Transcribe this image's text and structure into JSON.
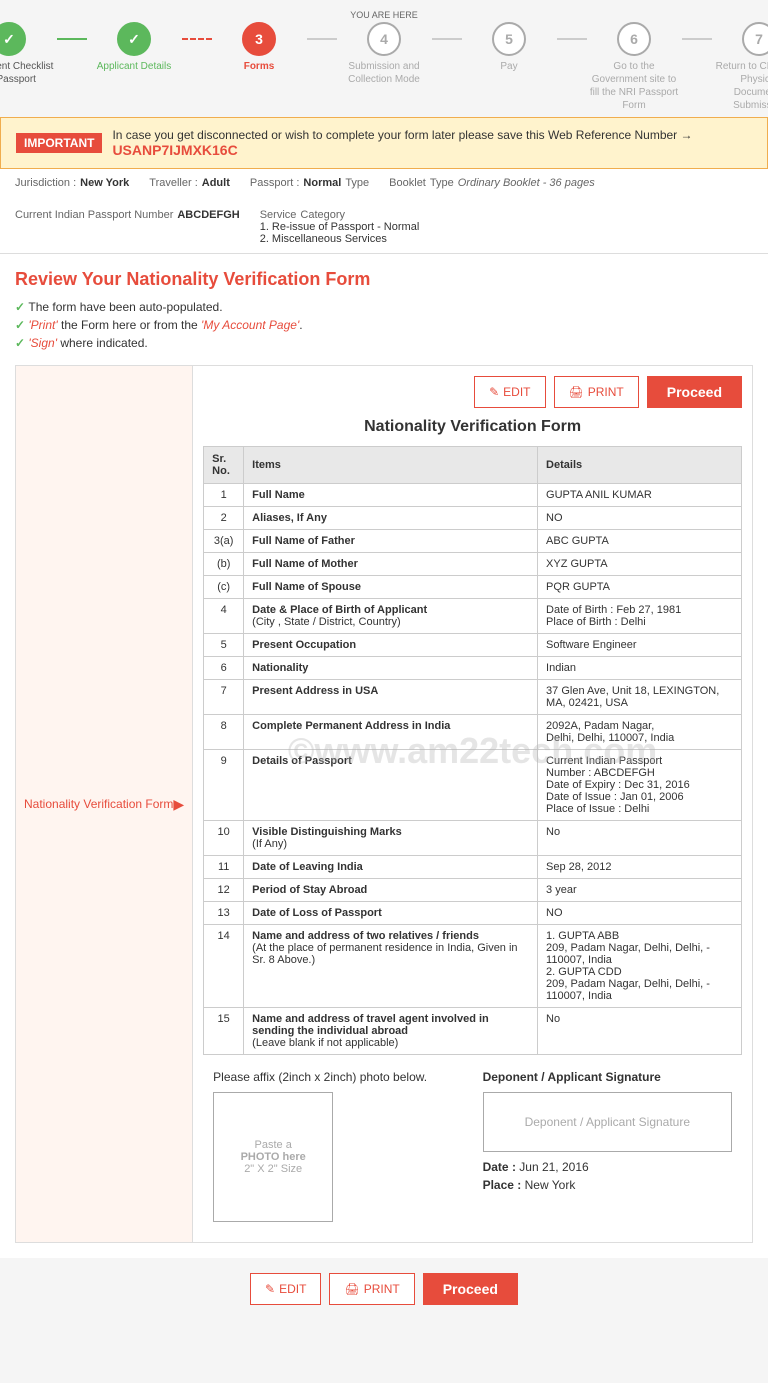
{
  "you_are_here": "YOU ARE HERE",
  "steps": [
    {
      "id": 1,
      "label": "Document Checklist for Passport",
      "state": "done",
      "icon": "✓"
    },
    {
      "id": 2,
      "label": "Applicant Details",
      "state": "done",
      "icon": "✓"
    },
    {
      "id": 3,
      "label": "Forms",
      "state": "active",
      "icon": "3"
    },
    {
      "id": 4,
      "label": "Submission and Collection Mode",
      "state": "inactive",
      "icon": "4"
    },
    {
      "id": 5,
      "label": "Pay",
      "state": "inactive",
      "icon": "5"
    },
    {
      "id": 6,
      "label": "Go to the Government site to fill the NRI Passport Form",
      "state": "inactive",
      "icon": "6"
    },
    {
      "id": 7,
      "label": "Return to CKGS for Physical Documents Submission",
      "state": "inactive",
      "icon": "7"
    }
  ],
  "banner": {
    "label": "IMPORTANT",
    "text": "In case you get disconnected or wish to complete your form later please save this Web Reference Number →",
    "ref_number": "USANP7IJMXK16C"
  },
  "info": {
    "jurisdiction_label": "Jurisdiction :",
    "jurisdiction_value": "New York",
    "traveller_label": "Traveller :",
    "traveller_value": "Adult",
    "passport_label": "Passport :",
    "passport_value": "Normal",
    "passport_type_label": "Type",
    "booklet_label": "Booklet",
    "booklet_type_label": "Type",
    "booklet_value": "Ordinary Booklet - 36 pages",
    "current_passport_label": "Current Indian Passport Number",
    "current_passport_value": "ABCDEFGH",
    "service_label": "Service",
    "service_cat_label": "Category",
    "service_value1": "1. Re-issue of Passport - Normal",
    "service_value2": "2. Miscellaneous Services"
  },
  "review": {
    "title_pre": "Review Your ",
    "title_highlight": "Nationality Verification Form",
    "checklist": [
      "The form have been auto-populated.",
      "'Print' the Form here or from the 'My Account Page'.",
      "'Sign' where indicated."
    ]
  },
  "sidebar": {
    "label": "Nationality Verification Form"
  },
  "form": {
    "title": "Nationality Verification Form",
    "edit_btn": "EDIT",
    "print_btn": "PRINT",
    "proceed_btn": "Proceed",
    "table_headers": [
      "Sr. No.",
      "Items",
      "Details"
    ],
    "rows": [
      {
        "sr": "1",
        "item": "Full Name",
        "detail": "GUPTA ANIL KUMAR",
        "bold": true,
        "sub": ""
      },
      {
        "sr": "2",
        "item": "Aliases, If Any",
        "detail": "NO",
        "bold": true,
        "sub": ""
      },
      {
        "sr": "3(a)",
        "item": "Full Name of Father",
        "detail": "ABC GUPTA",
        "bold": true,
        "sub": ""
      },
      {
        "sr": "(b)",
        "item": "Full Name of Mother",
        "detail": "XYZ GUPTA",
        "bold": true,
        "sub": ""
      },
      {
        "sr": "(c)",
        "item": "Full Name of Spouse",
        "detail": "PQR GUPTA",
        "bold": true,
        "sub": ""
      },
      {
        "sr": "4",
        "item": "Date & Place of Birth of Applicant",
        "sub": "(City , State / District, Country)",
        "detail": "Date of Birth : Feb 27, 1981\nPlace of Birth : Delhi",
        "bold": true
      },
      {
        "sr": "5",
        "item": "Present Occupation",
        "detail": "Software Engineer",
        "bold": true,
        "sub": ""
      },
      {
        "sr": "6",
        "item": "Nationality",
        "detail": "Indian",
        "bold": true,
        "sub": ""
      },
      {
        "sr": "7",
        "item": "Present Address in USA",
        "detail": "37 Glen Ave, Unit 18, LEXINGTON, MA, 02421, USA",
        "bold": true,
        "sub": ""
      },
      {
        "sr": "8",
        "item": "Complete Permanent Address in India",
        "detail": "2092A, Padam Nagar,\nDelhi, Delhi, 110007, India",
        "bold": true,
        "sub": ""
      },
      {
        "sr": "9",
        "item": "Details of Passport",
        "detail": "Current Indian Passport\nNumber : ABCDEFGH\nDate of Expiry : Dec 31, 2016\nDate of Issue : Jan 01, 2006\nPlace of Issue : Delhi",
        "bold": true,
        "sub": ""
      },
      {
        "sr": "10",
        "item": "Visible Distinguishing Marks",
        "sub": "(If Any)",
        "detail": "No",
        "bold": true
      },
      {
        "sr": "11",
        "item": "Date of Leaving India",
        "detail": "Sep 28, 2012",
        "bold": true,
        "sub": ""
      },
      {
        "sr": "12",
        "item": "Period of Stay Abroad",
        "detail": "3 year",
        "bold": true,
        "sub": ""
      },
      {
        "sr": "13",
        "item": "Date of Loss of Passport",
        "detail": "NO",
        "bold": true,
        "sub": ""
      },
      {
        "sr": "14",
        "item": "Name and address of two relatives / friends",
        "sub": "(At the place of permanent residence in India, Given in Sr. 8 Above.)",
        "detail": "1. GUPTA ABB\n209, Padam Nagar, Delhi, Delhi, - 110007, India\n2. GUPTA CDD\n209, Padam Nagar, Delhi, Delhi, - 110007, India",
        "bold": true
      },
      {
        "sr": "15",
        "item": "Name and address of travel agent involved in sending the individual abroad",
        "sub": "(Leave blank if not applicable)",
        "detail": "No",
        "bold": true
      }
    ]
  },
  "photo_section": {
    "label": "Please affix (2inch x 2inch) photo below.",
    "photo_line1": "Paste a",
    "photo_line2": "PHOTO here",
    "photo_line3": "2\" X 2\" Size"
  },
  "signature_section": {
    "label": "Deponent / Applicant Signature",
    "box_text": "Deponent / Applicant Signature",
    "date_label": "Date :",
    "date_value": "Jun 21, 2016",
    "place_label": "Place :",
    "place_value": "New York"
  },
  "watermark": "©www.am22tech.com"
}
